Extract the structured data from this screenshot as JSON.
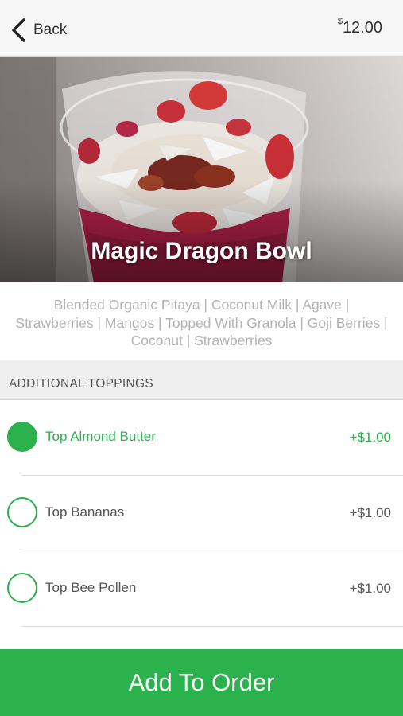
{
  "header": {
    "back_label": "Back",
    "price_symbol": "$",
    "price_amount": "12.00"
  },
  "product": {
    "title": "Magic Dragon Bowl",
    "description": "Blended Organic Pitaya | Coconut Milk | Agave | Strawberries | Mangos | Topped With Granola | Goji Berries | Coconut | Strawberries"
  },
  "toppings": {
    "heading": "ADDITIONAL TOPPINGS",
    "items": [
      {
        "name": "Top Almond Butter",
        "price": "+$1.00",
        "selected": true
      },
      {
        "name": "Top Bananas",
        "price": "+$1.00",
        "selected": false
      },
      {
        "name": "Top Bee Pollen",
        "price": "+$1.00",
        "selected": false
      }
    ]
  },
  "actions": {
    "add_label": "Add To Order"
  },
  "colors": {
    "accent": "#2bb24c",
    "header_bg": "#f6f6f6",
    "section_bg": "#efefef"
  },
  "icons": {
    "back": "chevron-left-icon",
    "radio": "radio-circle-icon"
  }
}
